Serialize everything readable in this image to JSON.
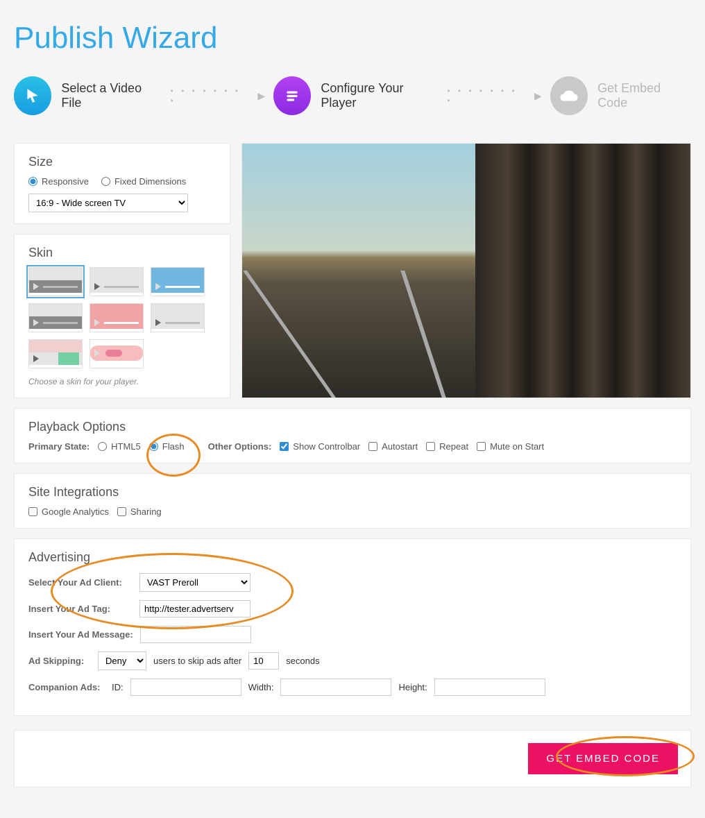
{
  "title": "Publish Wizard",
  "steps": {
    "select": "Select a Video File",
    "configure": "Configure Your Player",
    "embed": "Get Embed Code"
  },
  "size": {
    "heading": "Size",
    "responsive_label": "Responsive",
    "fixed_label": "Fixed Dimensions",
    "aspect_value": "16:9 - Wide screen TV"
  },
  "skin": {
    "heading": "Skin",
    "hint": "Choose a skin for your player."
  },
  "playback": {
    "heading": "Playback Options",
    "primary_label": "Primary State:",
    "html5_label": "HTML5",
    "flash_label": "Flash",
    "other_label": "Other Options:",
    "show_controlbar": "Show Controlbar",
    "autostart": "Autostart",
    "repeat": "Repeat",
    "mute": "Mute on Start"
  },
  "site": {
    "heading": "Site Integrations",
    "ga": "Google Analytics",
    "sharing": "Sharing"
  },
  "advertising": {
    "heading": "Advertising",
    "client_label": "Select Your Ad Client:",
    "client_value": "VAST Preroll",
    "tag_label": "Insert Your Ad Tag:",
    "tag_value": "http://tester.advertserv",
    "message_label": "Insert Your Ad Message:",
    "message_value": "",
    "skipping_label": "Ad Skipping:",
    "skip_mode": "Deny",
    "skip_mid": "users to skip ads after",
    "skip_seconds_value": "10",
    "skip_seconds_suffix": "seconds",
    "companion_label": "Companion Ads:",
    "id_label": "ID:",
    "id_value": "",
    "width_label": "Width:",
    "width_value": "",
    "height_label": "Height:",
    "height_value": ""
  },
  "footer": {
    "embed_button": "GET EMBED CODE"
  }
}
